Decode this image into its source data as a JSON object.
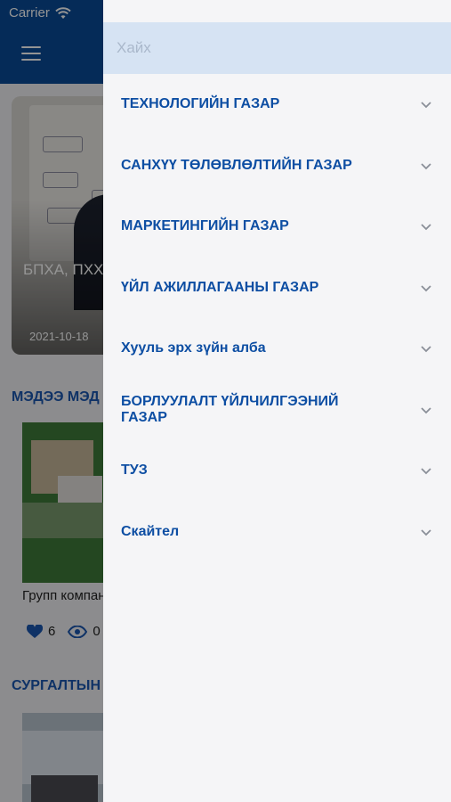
{
  "status_bar": {
    "carrier": "Carrier"
  },
  "background": {
    "featured": {
      "title": "БПХА, ПХХ Б.Мөнгөнт",
      "date": "2021-10-18"
    },
    "sections": {
      "news_title": "МЭДЭЭ МЭД",
      "training_title": "СУРГАЛТЫН"
    },
    "news_item": {
      "text": "Групп компани ажилчдын",
      "likes": "6",
      "views": "0"
    }
  },
  "drawer": {
    "search": {
      "placeholder": "Хайх",
      "value": ""
    },
    "items": [
      {
        "label": "ТЕХНОЛОГИЙН ГАЗАР"
      },
      {
        "label": "САНХҮҮ ТӨЛӨВЛӨЛТИЙН ГАЗАР"
      },
      {
        "label": "МАРКЕТИНГИЙН ГАЗАР"
      },
      {
        "label": "ҮЙЛ АЖИЛЛАГААНЫ ГАЗАР"
      },
      {
        "label": "Хууль эрх зүйн алба"
      },
      {
        "label": "БОРЛУУЛАЛТ ҮЙЛЧИЛГЭЭНИЙ ГАЗАР"
      },
      {
        "label": "ТУЗ"
      },
      {
        "label": "Скайтел"
      }
    ]
  },
  "colors": {
    "brand_blue": "#0a4a98",
    "menu_text": "#0d4ea3",
    "search_bg": "#d6e3f3"
  }
}
